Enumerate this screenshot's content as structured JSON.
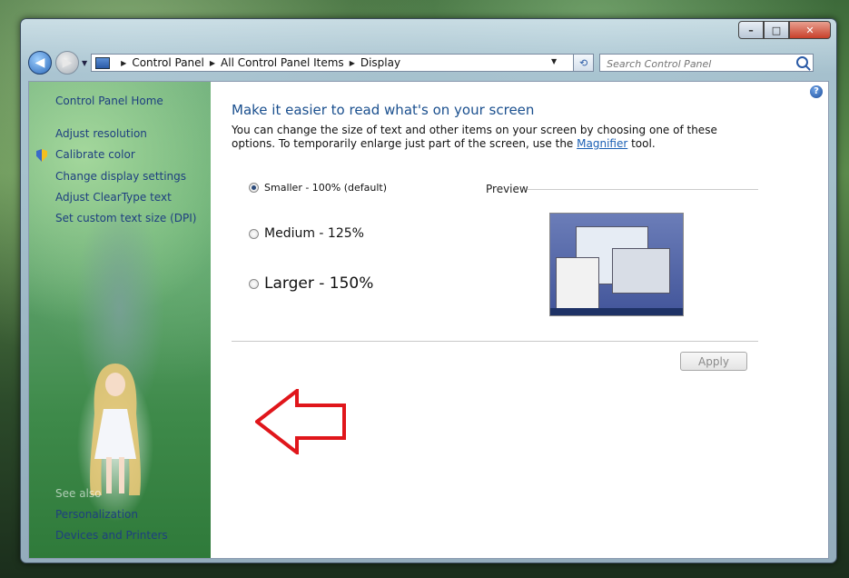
{
  "window": {
    "caption": {
      "minimize": "–",
      "maximize": "□",
      "close": "✕"
    }
  },
  "nav": {
    "breadcrumbs": [
      "Control Panel",
      "All Control Panel Items",
      "Display"
    ],
    "search_placeholder": "Search Control Panel"
  },
  "sidebar": {
    "home": "Control Panel Home",
    "links": [
      "Adjust resolution",
      "Calibrate color",
      "Change display settings",
      "Adjust ClearType text",
      "Set custom text size (DPI)"
    ],
    "see_also": "See also",
    "see_also_links": [
      "Personalization",
      "Devices and Printers"
    ]
  },
  "main": {
    "heading": "Make it easier to read what's on your screen",
    "desc_before": "You can change the size of text and other items on your screen by choosing one of these options. To temporarily enlarge just part of the screen, use the ",
    "desc_link": "Magnifier",
    "desc_after": " tool.",
    "options": [
      {
        "label": "Smaller - 100% (default)",
        "checked": true
      },
      {
        "label": "Medium - 125%",
        "checked": false
      },
      {
        "label": "Larger - 150%",
        "checked": false
      }
    ],
    "preview_label": "Preview",
    "apply_label": "Apply",
    "help": "?"
  },
  "colors": {
    "accent": "#1a4f8e",
    "link": "#1a5fb4",
    "annotation_arrow": "#e0161b"
  }
}
